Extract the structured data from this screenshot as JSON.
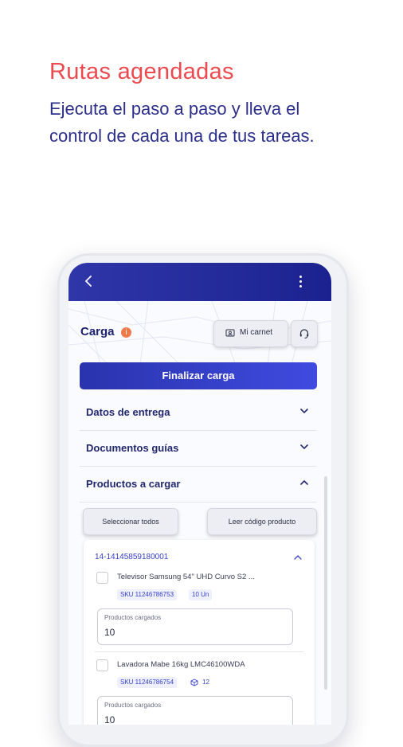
{
  "promo": {
    "headline": "Rutas agendadas",
    "subline": "Ejecuta el paso a paso y lleva el control de cada una de tus tareas."
  },
  "appbar": {
    "back_icon": "chevron-left-icon",
    "menu_icon": "more-vertical-icon"
  },
  "header": {
    "title": "Carga",
    "badge": "i",
    "carnet_label": "Mi carnet",
    "carnet_icon": "id-card-icon",
    "support_icon": "headset-icon"
  },
  "actions": {
    "finalize_label": "Finalizar carga"
  },
  "sections": [
    {
      "label": "Datos de entrega",
      "expanded": false
    },
    {
      "label": "Documentos guías",
      "expanded": false
    },
    {
      "label": "Productos a cargar",
      "expanded": true
    }
  ],
  "products_panel": {
    "select_all_label": "Seleccionar todos",
    "read_code_label": "Leer código producto",
    "order_id": "14-14145859180001",
    "items": [
      {
        "name": "Televisor Samsung 54\" UHD Curvo S2 ...",
        "sku": "SKU 11246786753",
        "qty": "10 Un",
        "field_label": "Productos cargados",
        "field_value": "10"
      },
      {
        "name": "Lavadora Mabe 16kg LMC46100WDA",
        "sku": "SKU 11246786754",
        "qty": "12",
        "field_label": "Productos cargados",
        "field_value": "10"
      }
    ]
  },
  "colors": {
    "headline": "#ec4a4f",
    "subline": "#2b2f8a",
    "primary": "#2a33ad",
    "badge": "#ef7a4c"
  }
}
